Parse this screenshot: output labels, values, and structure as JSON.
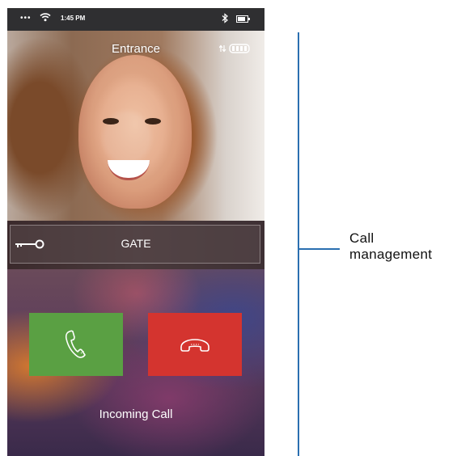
{
  "status_bar": {
    "signal_dots": "•••",
    "time": "1:45 PM",
    "icons": [
      "wifi-icon",
      "bluetooth-icon",
      "battery-icon"
    ]
  },
  "video": {
    "title": "Entrance",
    "icons": [
      "transfer-arrows-icon",
      "signal-strength-icon"
    ]
  },
  "gate": {
    "label": "GATE",
    "icon": "key-icon"
  },
  "call": {
    "accept_icon": "phone-icon",
    "decline_icon": "hang-up-icon",
    "status": "Incoming Call",
    "accept_color": "#5aa043",
    "decline_color": "#d4342f"
  },
  "annotation": {
    "line1": "Call",
    "line2": "management",
    "color": "#2a6fb0"
  }
}
